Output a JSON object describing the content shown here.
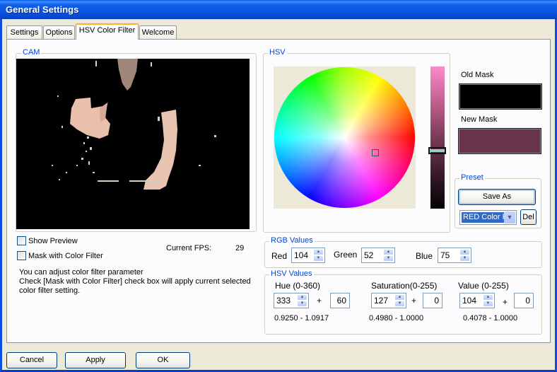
{
  "window": {
    "title": "General Settings"
  },
  "tabs": [
    {
      "label": "Settings",
      "active": false
    },
    {
      "label": "Options",
      "active": false
    },
    {
      "label": "HSV Color Filter",
      "active": true
    },
    {
      "label": "Welcome",
      "active": false
    }
  ],
  "cam": {
    "group_label": "CAM",
    "show_preview": {
      "label": "Show Preview",
      "checked": false
    },
    "mask_with_color_filter": {
      "label": "Mask with Color Filter",
      "checked": false
    },
    "fps_label": "Current FPS:",
    "fps_value": "29",
    "help_lines": [
      "You can adjust color filter parameter",
      "Check [Mask with Color Filter] check box will apply current selected",
      "color filter setting."
    ]
  },
  "hsv_picker": {
    "group_label": "HSV",
    "selected_hue_deg": 333,
    "selected_saturation": 127,
    "selected_value": 104
  },
  "masks": {
    "old_label": "Old Mask",
    "old_color": "#000000",
    "new_label": "New Mask",
    "new_color": "#68344b"
  },
  "preset": {
    "group_label": "Preset",
    "save_as_label": "Save As",
    "selected": "RED Color Filter",
    "selected_visible": "RED Color F",
    "delete_label": "Del"
  },
  "rgb": {
    "group_label": "RGB Values",
    "red_label": "Red",
    "red": "104",
    "green_label": "Green",
    "green": "52",
    "blue_label": "Blue",
    "blue": "75"
  },
  "hsv": {
    "group_label": "HSV Values",
    "hue_label": "Hue (0-360)",
    "hue": "333",
    "hue_tolerance": "60",
    "hue_range": "0.9250 - 1.0917",
    "sat_label": "Saturation(0-255)",
    "sat": "127",
    "sat_tolerance": "0",
    "sat_range": "0.4980 - 1.0000",
    "val_label": "Value (0-255)",
    "val": "104",
    "val_tolerance": "0",
    "val_range": "0.4078 - 1.0000",
    "plus": "+"
  },
  "buttons": {
    "cancel": "Cancel",
    "apply": "Apply",
    "ok": "OK"
  },
  "colors": {
    "titlebar": "#0a55e0",
    "accent_label": "#0046d5",
    "active_tab_highlight": "#f6b232",
    "dialog_bg": "#ece9d8"
  }
}
